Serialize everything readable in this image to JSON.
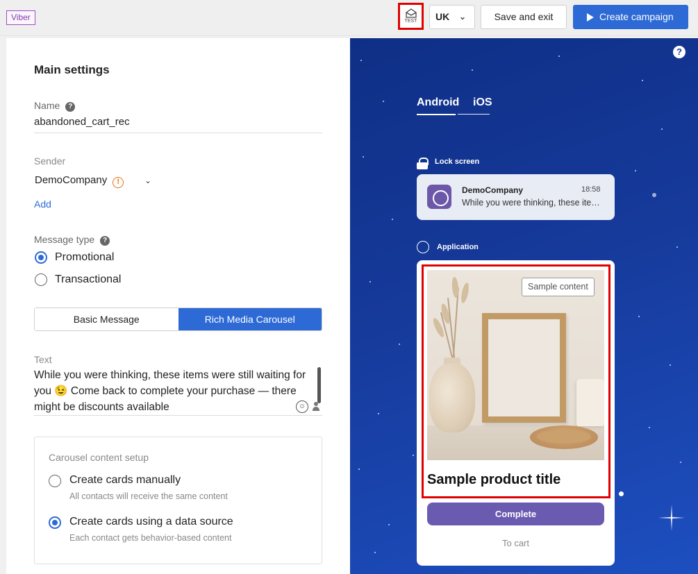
{
  "header": {
    "channel_tag": "Viber",
    "test_label": "TEST",
    "language": "UK",
    "save_label": "Save and exit",
    "create_label": "Create campaign"
  },
  "settings": {
    "title": "Main settings",
    "name_label": "Name",
    "name_value": "abandoned_cart_rec",
    "sender_label": "Sender",
    "sender_value": "DemoCompany",
    "add_link": "Add",
    "message_type_label": "Message type",
    "message_types": [
      "Promotional",
      "Transactional"
    ],
    "selected_message_type": "Promotional",
    "formats": [
      "Basic Message",
      "Rich Media Carousel"
    ],
    "active_format": "Rich Media Carousel",
    "text_label": "Text",
    "text_value": "While you were thinking, these items were still waiting for you 😉 Come back to complete your purchase — there might be discounts available",
    "carousel_setup": {
      "title": "Carousel content setup",
      "options": [
        {
          "label": "Create cards manually",
          "note": "All contacts will receive the same content",
          "checked": false
        },
        {
          "label": "Create cards using a data source",
          "note": "Each contact gets behavior-based content",
          "checked": true
        }
      ]
    }
  },
  "preview": {
    "tabs": [
      "Android",
      "iOS"
    ],
    "active_tab": "Android",
    "lock_screen_label": "Lock screen",
    "notification": {
      "sender": "DemoCompany",
      "time": "18:58",
      "body": "While you were thinking, these items were still waiting for you"
    },
    "application_label": "Application",
    "card": {
      "badge": "Sample content",
      "title": "Sample product title",
      "button": "Complete",
      "link": "To cart"
    }
  },
  "colors": {
    "accent": "#2d6ad6",
    "viber_purple": "#6a5ab0",
    "highlight_red": "#e00000",
    "preview_bg": "#163a9b"
  }
}
